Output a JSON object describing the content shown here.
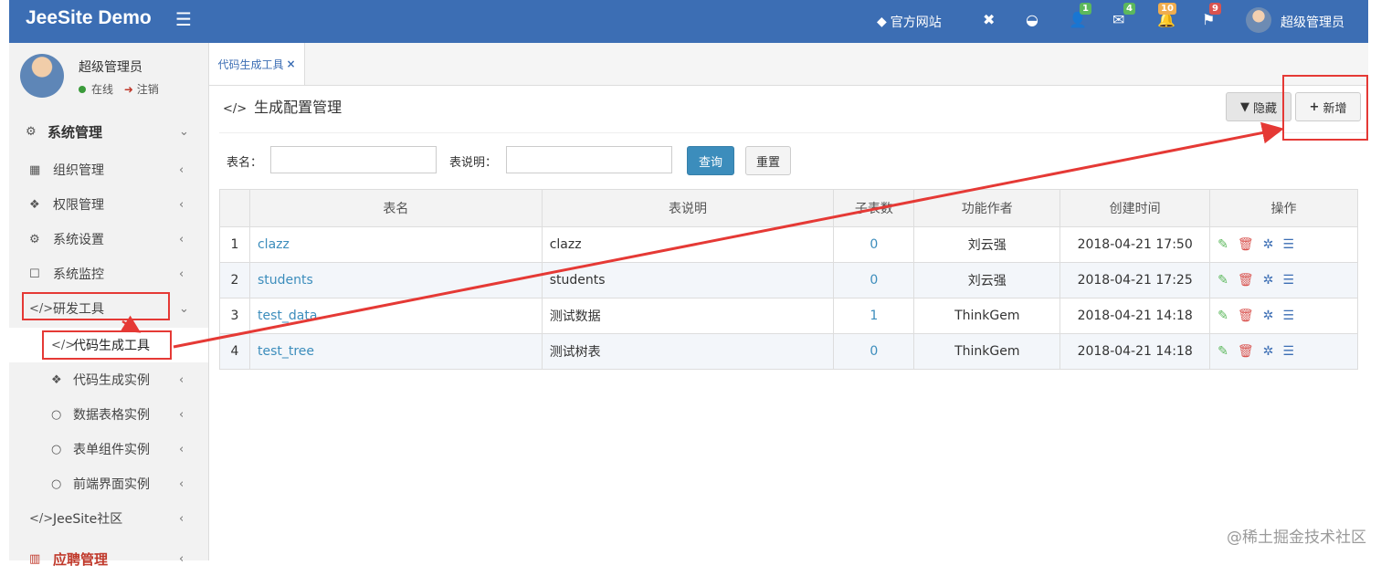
{
  "header": {
    "brand": "JeeSite Demo",
    "official_site": "官方网站",
    "badges": {
      "users": "1",
      "mail": "4",
      "bell": "10",
      "flag": "9"
    },
    "user": "超级管理员"
  },
  "sidebar": {
    "user": {
      "name": "超级管理员",
      "status": "在线",
      "logout": "注销"
    },
    "items": [
      {
        "label": "系统管理",
        "icon": "gear-icon"
      },
      {
        "label": "组织管理",
        "icon": "grid-icon"
      },
      {
        "label": "权限管理",
        "icon": "cube-icon"
      },
      {
        "label": "系统设置",
        "icon": "settings-icon"
      },
      {
        "label": "系统监控",
        "icon": "monitor-icon"
      },
      {
        "label": "研发工具",
        "icon": "code-icon"
      },
      {
        "label": "代码生成工具",
        "icon": "code-icon"
      },
      {
        "label": "代码生成实例",
        "icon": "cube-icon"
      },
      {
        "label": "数据表格实例",
        "icon": "circle-icon"
      },
      {
        "label": "表单组件实例",
        "icon": "circle-icon"
      },
      {
        "label": "前端界面实例",
        "icon": "circle-icon"
      },
      {
        "label": "JeeSite社区",
        "icon": "code-icon"
      },
      {
        "label": "应聘管理",
        "icon": "book-icon"
      }
    ]
  },
  "tabs": [
    {
      "label": "代码生成工具"
    }
  ],
  "panel": {
    "title": "生成配置管理",
    "hide_button": "隐藏",
    "add_button": "新增"
  },
  "search": {
    "table_name_label": "表名：",
    "table_desc_label": "表说明：",
    "query_button": "查询",
    "reset_button": "重置"
  },
  "table": {
    "headers": [
      "表名",
      "表说明",
      "子表数",
      "功能作者",
      "创建时间",
      "操作"
    ],
    "rows": [
      {
        "idx": "1",
        "name": "clazz",
        "desc": "clazz",
        "children": "0",
        "author": "刘云强",
        "created": "2018-04-21 17:50"
      },
      {
        "idx": "2",
        "name": "students",
        "desc": "students",
        "children": "0",
        "author": "刘云强",
        "created": "2018-04-21 17:25"
      },
      {
        "idx": "3",
        "name": "test_data",
        "desc": "测试数据",
        "children": "1",
        "author": "ThinkGem",
        "created": "2018-04-21 14:18"
      },
      {
        "idx": "4",
        "name": "test_tree",
        "desc": "测试树表",
        "children": "0",
        "author": "ThinkGem",
        "created": "2018-04-21 14:18"
      }
    ]
  },
  "watermark": "@稀土掘金技术社区",
  "colors": {
    "header": "#3c6eb4",
    "annotation": "#e53935",
    "primary": "#3c8dbc"
  }
}
